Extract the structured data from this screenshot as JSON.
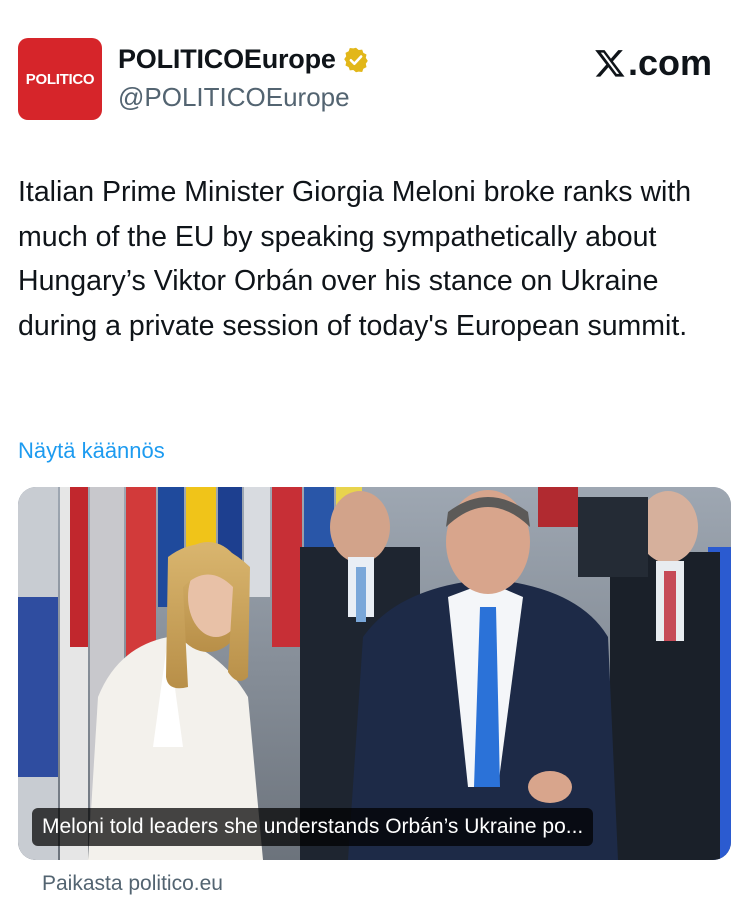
{
  "author": {
    "avatar_text": "POLITICO",
    "display_name": "POLITICOEurope",
    "handle": "@POLITICOEurope",
    "verified_icon": "verified-badge-gold",
    "avatar_color": "#d6252a"
  },
  "platform": {
    "label": ".com",
    "icon": "x-logo-icon"
  },
  "tweet": {
    "text": "Italian Prime Minister Giorgia Meloni broke ranks with much of the EU by speaking sympathetically about Hungary’s Viktor Orbán over his stance on Ukraine during a private session of today's European summit.",
    "translate_label": "Näytä käännös"
  },
  "link_card": {
    "caption": "Meloni told leaders she understands Orbán’s Ukraine po...",
    "source": "Paikasta politico.eu"
  },
  "colors": {
    "link": "#1d9bf0",
    "secondary_text": "#536471",
    "verified": "#e2b719"
  }
}
